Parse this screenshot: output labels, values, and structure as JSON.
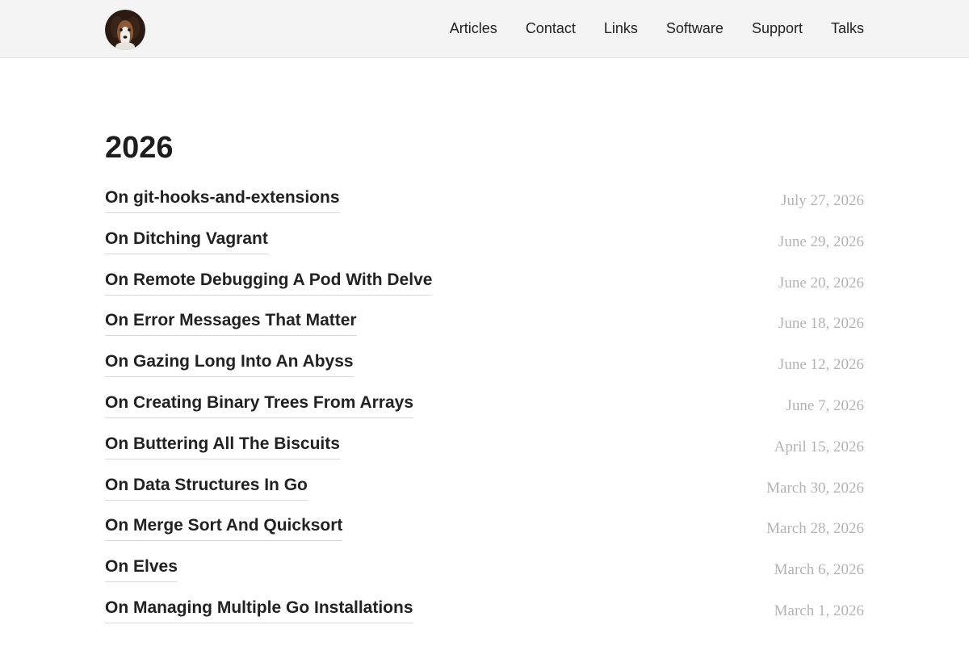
{
  "header": {
    "avatar_icon": "dog-avatar-icon",
    "nav": [
      {
        "label": "Articles"
      },
      {
        "label": "Contact"
      },
      {
        "label": "Links"
      },
      {
        "label": "Software"
      },
      {
        "label": "Support"
      },
      {
        "label": "Talks"
      }
    ]
  },
  "main": {
    "year": "2026",
    "posts": [
      {
        "title": "On git-hooks-and-extensions",
        "date": "July 27, 2026"
      },
      {
        "title": "On Ditching Vagrant",
        "date": "June 29, 2026"
      },
      {
        "title": "On Remote Debugging A Pod With Delve",
        "date": "June 20, 2026"
      },
      {
        "title": "On Error Messages That Matter",
        "date": "June 18, 2026"
      },
      {
        "title": "On Gazing Long Into An Abyss",
        "date": "June 12, 2026"
      },
      {
        "title": "On Creating Binary Trees From Arrays",
        "date": "June 7, 2026"
      },
      {
        "title": "On Buttering All The Biscuits",
        "date": "April 15, 2026"
      },
      {
        "title": "On Data Structures In Go",
        "date": "March 30, 2026"
      },
      {
        "title": "On Merge Sort And Quicksort",
        "date": "March 28, 2026"
      },
      {
        "title": "On Elves",
        "date": "March 6, 2026"
      },
      {
        "title": "On Managing Multiple Go Installations",
        "date": "March 1, 2026"
      }
    ]
  },
  "colors": {
    "header_bg": "#f4f4f4",
    "text": "#222222",
    "date": "#b3b3b3"
  }
}
